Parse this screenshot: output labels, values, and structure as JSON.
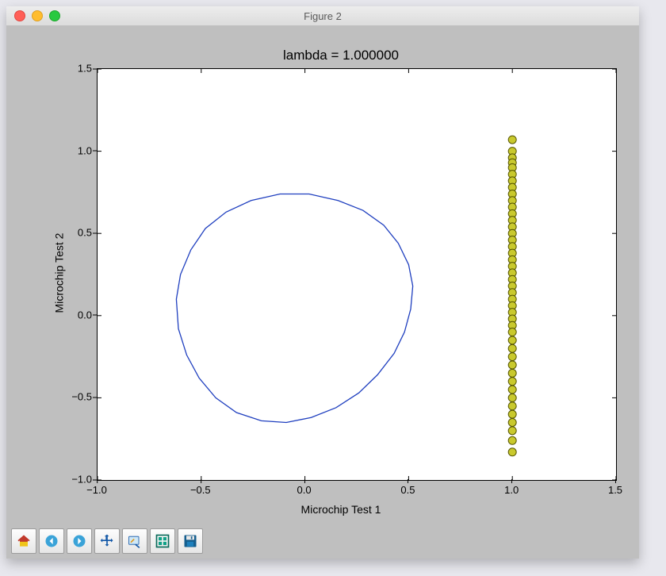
{
  "window": {
    "title": "Figure 2"
  },
  "chart_data": {
    "type": "line+scatter",
    "title": "lambda = 1.000000",
    "xlabel": "Microchip Test 1",
    "ylabel": "Microchip Test 2",
    "xlim": [
      -1.0,
      1.5
    ],
    "ylim": [
      -1.0,
      1.5
    ],
    "xticks": [
      -1.0,
      -0.5,
      0.0,
      0.5,
      1.0,
      1.5
    ],
    "yticks": [
      -1.0,
      -0.5,
      0.0,
      0.5,
      1.0,
      1.5
    ],
    "series": [
      {
        "name": "decision-boundary",
        "type": "line",
        "color": "#1f3fbf",
        "x": [
          -0.62,
          -0.6,
          -0.55,
          -0.48,
          -0.38,
          -0.26,
          -0.12,
          0.02,
          0.16,
          0.28,
          0.38,
          0.45,
          0.5,
          0.52,
          0.51,
          0.48,
          0.43,
          0.35,
          0.26,
          0.15,
          0.03,
          -0.09,
          -0.21,
          -0.33,
          -0.43,
          -0.51,
          -0.57,
          -0.61,
          -0.62
        ],
        "y": [
          0.1,
          0.25,
          0.4,
          0.53,
          0.63,
          0.7,
          0.74,
          0.74,
          0.7,
          0.64,
          0.55,
          0.44,
          0.31,
          0.18,
          0.04,
          -0.1,
          -0.23,
          -0.36,
          -0.47,
          -0.56,
          -0.62,
          -0.65,
          -0.64,
          -0.59,
          -0.5,
          -0.38,
          -0.24,
          -0.08,
          0.1
        ]
      },
      {
        "name": "data-points",
        "type": "scatter",
        "marker": "circle",
        "color": "#c9c92d",
        "edge": "#555500",
        "x": [
          1.0,
          1.0,
          1.0,
          1.0,
          1.0,
          1.0,
          1.0,
          1.0,
          1.0,
          1.0,
          1.0,
          1.0,
          1.0,
          1.0,
          1.0,
          1.0,
          1.0,
          1.0,
          1.0,
          1.0,
          1.0,
          1.0,
          1.0,
          1.0,
          1.0,
          1.0,
          1.0,
          1.0,
          1.0,
          1.0,
          1.0,
          1.0,
          1.0,
          1.0,
          1.0,
          1.0,
          1.0,
          1.0,
          1.0,
          1.0,
          1.0,
          1.0,
          1.0,
          1.0
        ],
        "y": [
          1.07,
          1.0,
          0.96,
          0.93,
          0.9,
          0.86,
          0.82,
          0.78,
          0.74,
          0.7,
          0.66,
          0.62,
          0.58,
          0.54,
          0.5,
          0.46,
          0.42,
          0.38,
          0.34,
          0.3,
          0.26,
          0.22,
          0.18,
          0.14,
          0.1,
          0.06,
          0.02,
          -0.02,
          -0.06,
          -0.1,
          -0.15,
          -0.2,
          -0.25,
          -0.3,
          -0.35,
          -0.4,
          -0.45,
          -0.5,
          -0.55,
          -0.6,
          -0.65,
          -0.7,
          -0.76,
          -0.83
        ]
      }
    ]
  },
  "toolbar": {
    "buttons": [
      {
        "id": "home",
        "name": "home-icon"
      },
      {
        "id": "back",
        "name": "back-icon"
      },
      {
        "id": "forward",
        "name": "forward-icon"
      },
      {
        "id": "pan",
        "name": "move-icon"
      },
      {
        "id": "zoom",
        "name": "zoom-rect-icon"
      },
      {
        "id": "subplots",
        "name": "subplots-icon"
      },
      {
        "id": "save",
        "name": "save-icon"
      }
    ]
  },
  "tick_labels": {
    "x": [
      "−1.0",
      "−0.5",
      "0.0",
      "0.5",
      "1.0",
      "1.5"
    ],
    "y": [
      "−1.0",
      "−0.5",
      "0.0",
      "0.5",
      "1.0",
      "1.5"
    ]
  }
}
